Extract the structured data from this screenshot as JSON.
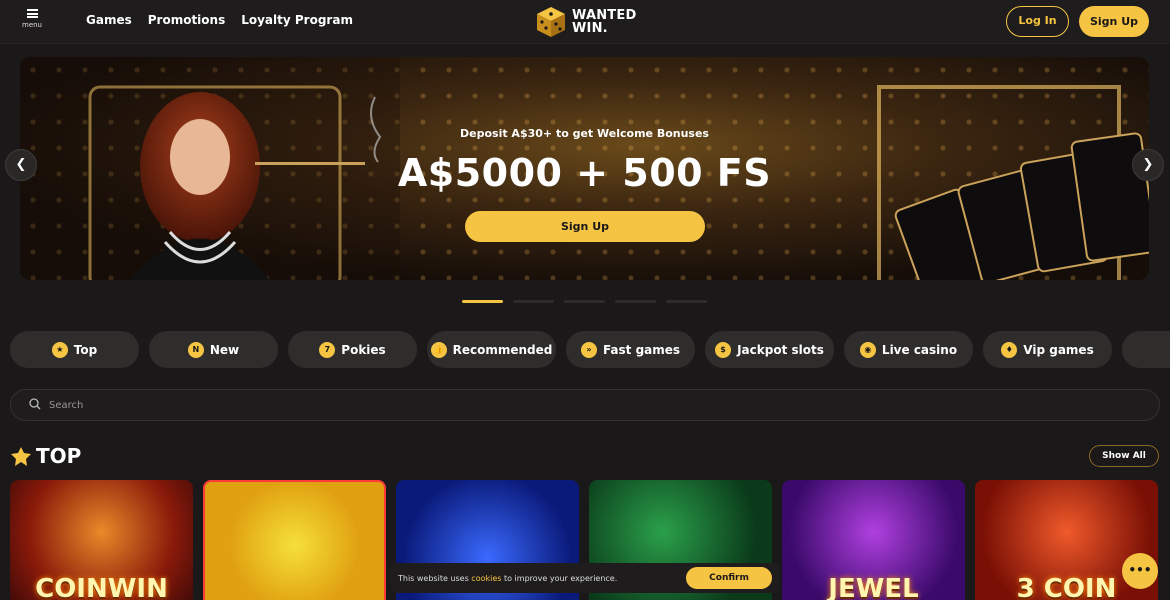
{
  "header": {
    "menu_label": "menu",
    "nav": [
      "Games",
      "Promotions",
      "Loyalty Program"
    ],
    "logo_line1": "WANTED",
    "logo_line2": "WIN.",
    "login_label": "Log In",
    "signup_label": "Sign Up"
  },
  "banner": {
    "subtitle": "Deposit A$30+ to get Welcome Bonuses",
    "title": "A$5000 + 500 FS",
    "cta_label": "Sign Up",
    "prev_icon": "chevron-left-icon",
    "next_icon": "chevron-right-icon",
    "slide_count": 5,
    "active_slide": 1
  },
  "categories": [
    {
      "label": "Top",
      "icon": "top-crown-icon",
      "glyph": "★"
    },
    {
      "label": "New",
      "icon": "new-badge-icon",
      "glyph": "N"
    },
    {
      "label": "Pokies",
      "icon": "pokies-icon",
      "glyph": "7"
    },
    {
      "label": "Recommended",
      "icon": "thumbs-up-icon",
      "glyph": "👍"
    },
    {
      "label": "Fast games",
      "icon": "fast-icon",
      "glyph": "»"
    },
    {
      "label": "Jackpot slots",
      "icon": "money-bag-icon",
      "glyph": "$"
    },
    {
      "label": "Live casino",
      "icon": "chip-icon",
      "glyph": "◉"
    },
    {
      "label": "Vip games",
      "icon": "ticket-icon",
      "glyph": "♦"
    },
    {
      "label": "",
      "icon": "more-games-icon",
      "glyph": "▦"
    }
  ],
  "search": {
    "placeholder": "Search"
  },
  "section": {
    "title": "TOP",
    "show_all_label": "Show All"
  },
  "games": [
    {
      "name": "COINWIN",
      "theme": "g1"
    },
    {
      "name": "",
      "theme": "g2"
    },
    {
      "name": "",
      "theme": "g3"
    },
    {
      "name": "",
      "theme": "g4"
    },
    {
      "name": "JEWEL",
      "theme": "g5"
    },
    {
      "name": "3 COIN",
      "theme": "g6"
    }
  ],
  "cookie": {
    "text_before": "This website uses ",
    "link": "cookies",
    "text_after": " to improve your experience.",
    "confirm_label": "Confirm"
  },
  "colors": {
    "accent": "#f6c443",
    "background": "#1a1818",
    "pill": "#2f2c2c"
  }
}
